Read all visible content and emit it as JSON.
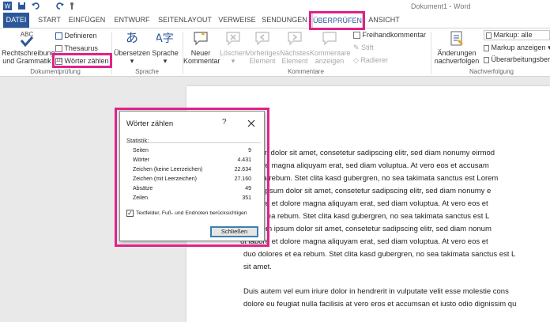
{
  "title": "Dokument1 - Word",
  "tabs": [
    "DATEI",
    "START",
    "EINFÜGEN",
    "ENTWURF",
    "SEITENLAYOUT",
    "VERWEISE",
    "SENDUNGEN",
    "ÜBERPRÜFEN",
    "ANSICHT"
  ],
  "ribbon": {
    "spelling": "Rechtschreibung und Grammatik",
    "spelling_l1": "Rechtschreibung",
    "spelling_l2": "und Grammatik",
    "define": "Definieren",
    "thesaurus": "Thesaurus",
    "word_count": "Wörter zählen",
    "group_proofing": "Dokumentprüfung",
    "translate": "Übersetzen",
    "language": "Sprache",
    "group_language": "Sprache",
    "new_comment_l1": "Neuer",
    "new_comment_l2": "Kommentar",
    "delete": "Löschen",
    "previous_l1": "Vorheriges",
    "previous_l2": "Element",
    "next_l1": "Nächstes",
    "next_l2": "Element",
    "show_comments_l1": "Kommentare",
    "show_comments_l2": "anzeigen",
    "freehand_comment": "Freihandkommentar",
    "pen": "Stift",
    "eraser": "Radierer",
    "group_comments": "Kommentare",
    "track_changes_l1": "Änderungen",
    "track_changes_l2": "nachverfolgen",
    "markup_all": "Markup: alle",
    "show_markup": "Markup anzeigen",
    "reviewing_pane": "Überarbeitungsber",
    "group_tracking": "Nachverfolgung"
  },
  "dialog": {
    "title": "Wörter zählen",
    "help": "?",
    "statistics_label": "Statistik:",
    "stats": [
      {
        "label": "Seiten",
        "value": "9"
      },
      {
        "label": "Wörter",
        "value": "4.431"
      },
      {
        "label": "Zeichen (keine Leerzeichen)",
        "value": "22.634"
      },
      {
        "label": "Zeichen (mit Leerzeichen)",
        "value": "27.160"
      },
      {
        "label": "Absätze",
        "value": "49"
      },
      {
        "label": "Zeilen",
        "value": "351"
      }
    ],
    "checkbox_label": "Textfelder, Fuß- und Endnoten berücksichtigen",
    "checkbox_checked": true,
    "close_button": "Schließen"
  },
  "document_lines": [
    "m ipsum dolor sit amet, consetetur sadipscing elitr, sed diam nonumy eirmod",
    "et dolore magna aliquyam erat, sed diam voluptua. At vero eos et accusam",
    "es et ea rebum. Stet clita kasd gubergren, no sea takimata sanctus est Lorem",
    "Lorem ipsum dolor sit amet, consetetur sadipscing elitr, sed diam nonumy e",
    "ut labore et dolore magna aliquyam erat, sed diam voluptua. At vero eos et",
    "lores et ea rebum. Stet clita kasd gubergren, no sea takimata sanctus est L",
    "et. Lorem ipsum dolor sit amet, consetetur sadipscing elitr, sed diam nonum",
    "ut labore et dolore magna aliquyam erat, sed diam voluptua. At vero eos et",
    "duo dolores et ea rebum. Stet clita kasd gubergren, no sea takimata sanctus est L",
    "sit amet."
  ],
  "document_lines_2": [
    "Duis autem vel eum iriure dolor in hendrerit in vulputate velit esse molestie cons",
    "dolore eu feugiat nulla facilisis at vero eros et accumsan et iusto odio dignissim qu"
  ],
  "colors": {
    "file_tab": "#2b579a",
    "highlight": "#e0228a"
  }
}
